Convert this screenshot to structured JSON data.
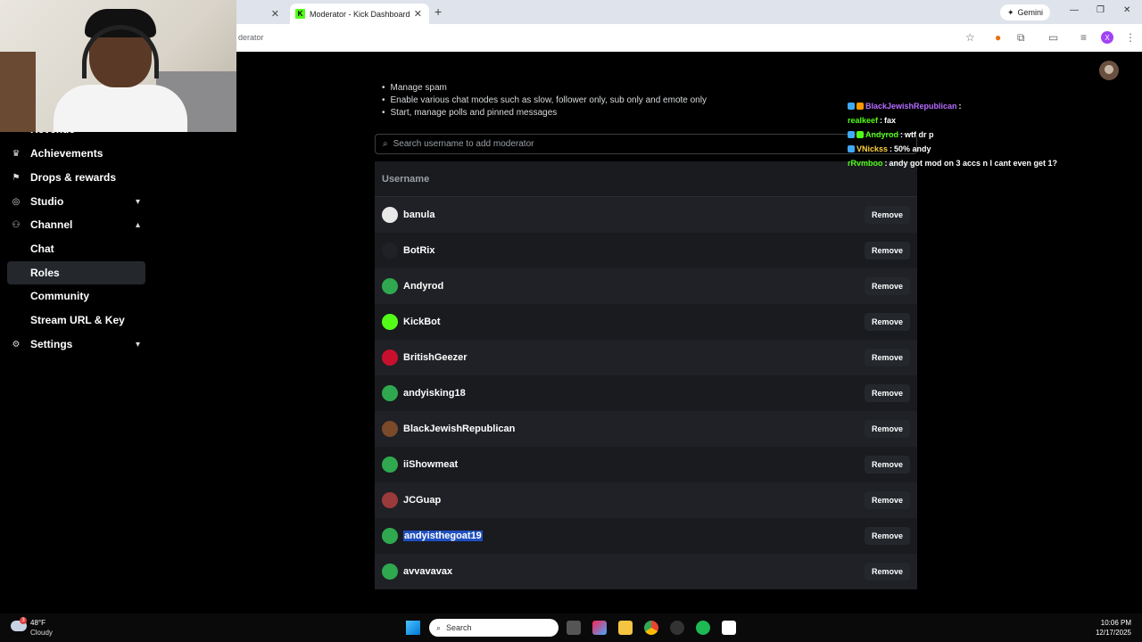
{
  "browser": {
    "tabs": [
      {
        "label": "",
        "active": false
      },
      {
        "label": "Moderator - Kick Dashboard",
        "active": true
      }
    ],
    "url_fragment": "derator",
    "gemini_label": "Gemini",
    "profile_initial": "X"
  },
  "sidebar": {
    "partial_item": "Revenue",
    "items": [
      {
        "label": "Achievements",
        "icon": "trophy-icon",
        "glyph": "🏆"
      },
      {
        "label": "Drops & rewards",
        "icon": "drops-icon",
        "glyph": "⚑"
      },
      {
        "label": "Studio",
        "icon": "studio-icon",
        "glyph": "◎",
        "chevron": "⌄"
      },
      {
        "label": "Channel",
        "icon": "channel-icon",
        "glyph": "⚇",
        "chevron": "⌃"
      },
      {
        "label": "Chat"
      },
      {
        "label": "Roles",
        "selected": true
      },
      {
        "label": "Community"
      },
      {
        "label": "Stream URL & Key"
      },
      {
        "label": "Settings",
        "icon": "gear-icon",
        "glyph": "⚙",
        "chevron": "⌄"
      }
    ]
  },
  "permissions": [
    "Manage spam",
    "Enable various chat modes such as slow, follower only, sub only and emote only",
    "Start, manage polls and pinned messages"
  ],
  "search": {
    "placeholder": "Search username to add moderator"
  },
  "table": {
    "header": "Username",
    "remove_label": "Remove",
    "rows": [
      {
        "username": "banula",
        "avatar_color": "#e8e8e8"
      },
      {
        "username": "BotRix",
        "avatar_color": "#1f2126"
      },
      {
        "username": "Andyrod",
        "avatar_color": "#2fa84f"
      },
      {
        "username": "KickBot",
        "avatar_color": "#53fc18"
      },
      {
        "username": "BritishGeezer",
        "avatar_color": "#c8102e"
      },
      {
        "username": "andyisking18",
        "avatar_color": "#2fa84f"
      },
      {
        "username": "BlackJewishRepublican",
        "avatar_color": "#7a4a2a"
      },
      {
        "username": "iiShowmeat",
        "avatar_color": "#2fa84f"
      },
      {
        "username": "JCGuap",
        "avatar_color": "#9a3a3a"
      },
      {
        "username": "andyisthegoat19",
        "avatar_color": "#2fa84f",
        "highlighted": true
      },
      {
        "username": "avvavavax",
        "avatar_color": "#2fa84f"
      }
    ]
  },
  "chat": [
    {
      "user": "BlackJewishRepublican",
      "user_color": "#b66dff",
      "text": "",
      "badges": [
        "#3fa9f5",
        "#ff9900"
      ]
    },
    {
      "user": "realkeef",
      "user_color": "#53fc18",
      "text": "fax",
      "badges": []
    },
    {
      "user": "Andyrod",
      "user_color": "#53fc18",
      "text": "wtf dr p",
      "badges": [
        "#3fa9f5",
        "#53fc18"
      ]
    },
    {
      "user": "VNickss",
      "user_color": "#ffd23f",
      "text": "50% andy",
      "badges": [
        "#3fa9f5"
      ]
    },
    {
      "user": "rRvmboo",
      "user_color": "#53fc18",
      "text": "andy got mod on 3 accs n I cant even get 1?",
      "badges": []
    }
  ],
  "taskbar": {
    "weather_temp": "48°F",
    "weather_cond": "Cloudy",
    "weather_badge": "3",
    "search_label": "Search",
    "time": "10:06 PM",
    "date": "12/17/2025"
  }
}
